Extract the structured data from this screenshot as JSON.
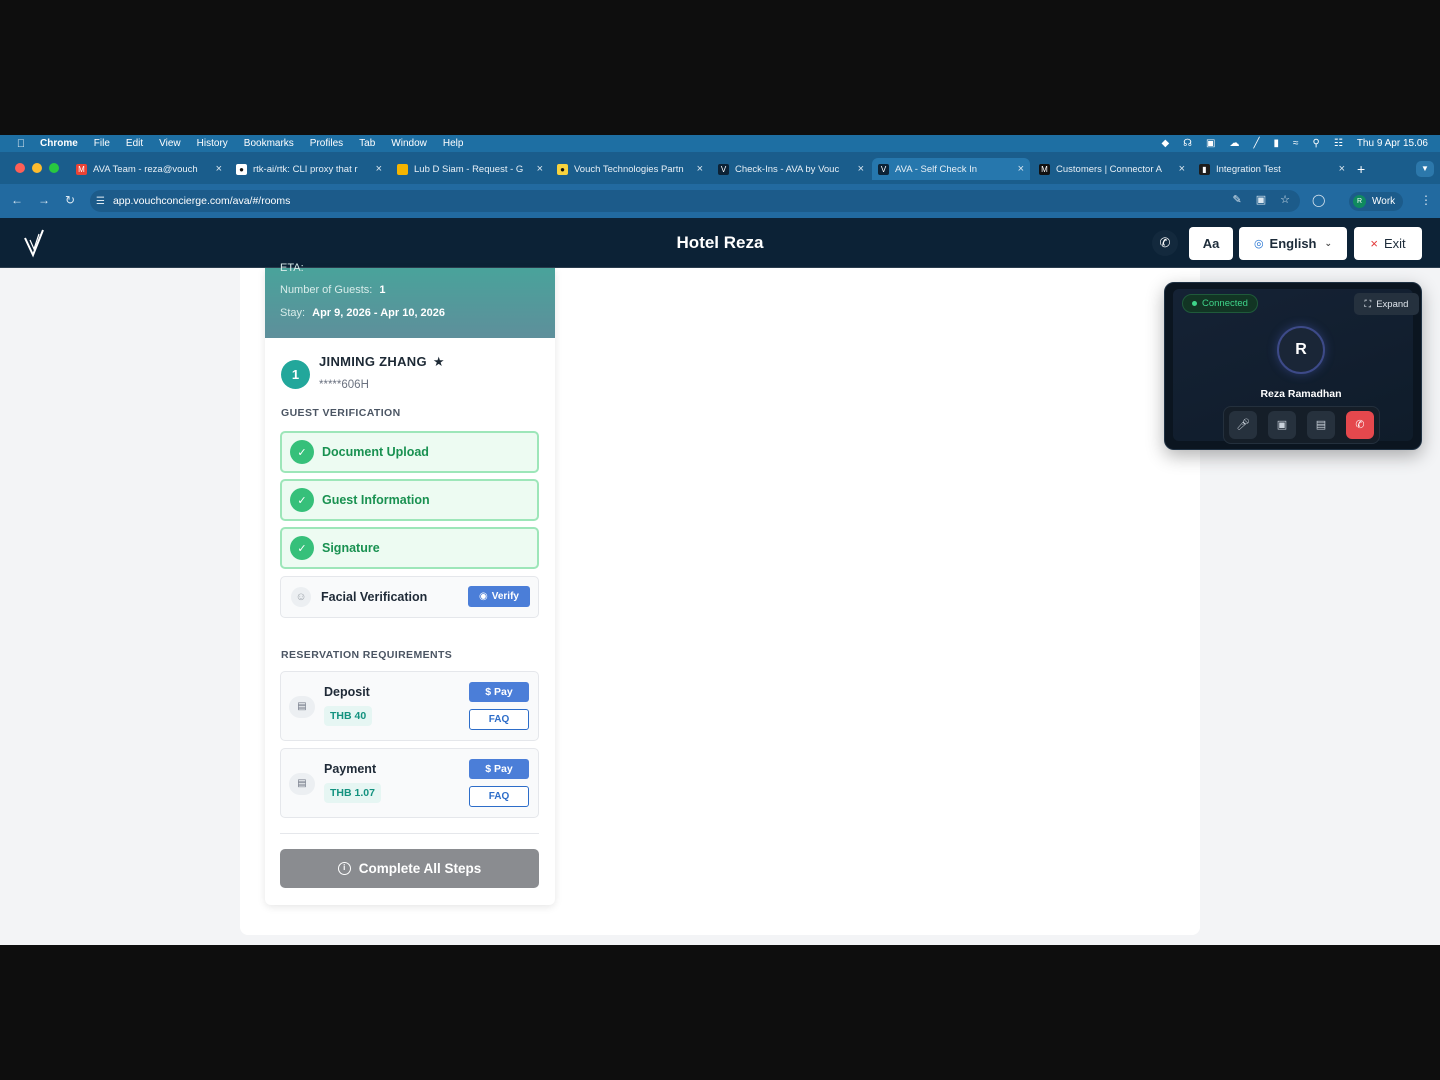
{
  "menubar": {
    "app": "Chrome",
    "items": [
      "File",
      "Edit",
      "View",
      "History",
      "Bookmarks",
      "Profiles",
      "Tab",
      "Window",
      "Help"
    ],
    "clock": "Thu 9 Apr  15.06"
  },
  "tabs": [
    {
      "title": "AVA Team - reza@vouch",
      "favicon": "gmail-icon",
      "color": "#ea4335"
    },
    {
      "title": "rtk-ai/rtk: CLI proxy that r",
      "favicon": "github-icon",
      "color": "#ffffff"
    },
    {
      "title": "Lub D Siam - Request - G",
      "favicon": "slides-icon",
      "color": "#f4b400"
    },
    {
      "title": "Vouch Technologies Partn",
      "favicon": "vouch-icon",
      "color": "#f7d23e"
    },
    {
      "title": "Check-Ins - AVA by Vouc",
      "favicon": "ava-icon",
      "color": "#0c2236"
    },
    {
      "title": "AVA - Self Check In",
      "favicon": "ava-icon",
      "color": "#0c2236"
    },
    {
      "title": "Customers | Connector A",
      "favicon": "m-icon",
      "color": "#111111"
    },
    {
      "title": "Integration Test",
      "favicon": "integration-icon",
      "color": "#1d1d1d"
    }
  ],
  "address": {
    "url": "app.vouchconcierge.com/ava/#/rooms",
    "profile_label": "Work",
    "profile_initial": "R"
  },
  "header": {
    "hotel_name": "Hotel Reza",
    "font_button": "Aa",
    "language": "English",
    "exit": "Exit"
  },
  "reservation": {
    "eta_label": "ETA:",
    "guests_label": "Number of Guests:",
    "guests_value": "1",
    "stay_label": "Stay:",
    "stay_value": "Apr 9, 2026 - Apr 10, 2026"
  },
  "guest": {
    "number": "1",
    "name": "JINMING ZHANG",
    "id_masked": "*****606H"
  },
  "verification": {
    "section_title": "GUEST VERIFICATION",
    "steps": [
      {
        "label": "Document Upload",
        "status": "done"
      },
      {
        "label": "Guest Information",
        "status": "done"
      },
      {
        "label": "Signature",
        "status": "done"
      },
      {
        "label": "Facial Verification",
        "status": "pending"
      }
    ],
    "verify_button": "Verify"
  },
  "requirements": {
    "section_title": "RESERVATION REQUIREMENTS",
    "items": [
      {
        "title": "Deposit",
        "amount": "THB 40",
        "pay": "$  Pay",
        "faq": "FAQ"
      },
      {
        "title": "Payment",
        "amount": "THB 1.07",
        "pay": "$  Pay",
        "faq": "FAQ"
      }
    ]
  },
  "complete_button": "Complete All Steps",
  "call": {
    "status": "Connected",
    "expand": "Expand",
    "initial": "R",
    "caller": "Reza Ramadhan"
  },
  "colors": {
    "brand_dark": "#0c2236",
    "success": "#36c07a",
    "primary": "#4b7ed8",
    "danger": "#e5484d"
  }
}
